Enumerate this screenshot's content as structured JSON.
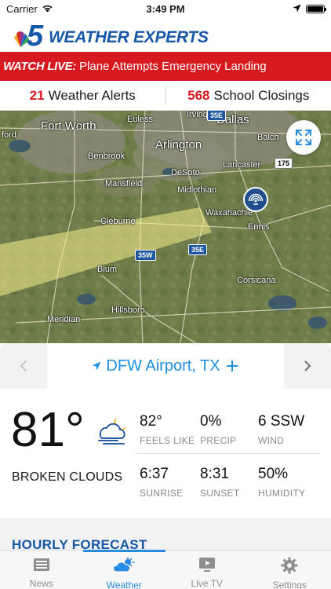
{
  "status_bar": {
    "carrier": "Carrier",
    "time": "3:49 PM"
  },
  "brand": {
    "logo_number": "5",
    "title": "WEATHER EXPERTS"
  },
  "breaking": {
    "tag": "WATCH LIVE:",
    "text": "Plane Attempts Emergency Landing"
  },
  "alerts": [
    {
      "count": "21",
      "label": "Weather Alerts"
    },
    {
      "count": "568",
      "label": "School Closings"
    }
  ],
  "map": {
    "labels": {
      "fort_worth": "Fort Worth",
      "euless": "Euless",
      "irving": "Irving",
      "dallas": "Dallas",
      "arlington": "Arlington",
      "benbrook": "Benbrook",
      "desoto": "DeSoto",
      "lancaster": "Lancaster",
      "balch": "Balch",
      "mansfield": "Mansfield",
      "midlothian": "Midlothian",
      "waxahachie": "Waxahachie",
      "cleburne": "Cleburne",
      "ennis": "Ennis",
      "blum": "Blum",
      "corsicana": "Corsicana",
      "hillsboro": "Hillsboro",
      "meridian": "Meridian",
      "ford": "ford"
    },
    "shields": {
      "i35w": "35W",
      "i35e": "35E",
      "i35e_top": "35E",
      "sh175": "175"
    }
  },
  "location": {
    "name": "DFW Airport, TX"
  },
  "current": {
    "temperature": "81°",
    "condition": "BROKEN CLOUDS",
    "stats": [
      {
        "value": "82°",
        "label": "FEELS LIKE"
      },
      {
        "value": "0%",
        "label": "PRECIP"
      },
      {
        "value": "6 SSW",
        "label": "WIND"
      },
      {
        "value": "6:37",
        "label": "SUNRISE"
      },
      {
        "value": "8:31",
        "label": "SUNSET"
      },
      {
        "value": "50%",
        "label": "HUMIDITY"
      }
    ]
  },
  "hourly": {
    "title": "HOURLY FORECAST"
  },
  "tabs": [
    {
      "label": "News",
      "icon": "news-icon"
    },
    {
      "label": "Weather",
      "icon": "weather-icon",
      "active": true
    },
    {
      "label": "Live TV",
      "icon": "live-tv-icon"
    },
    {
      "label": "Settings",
      "icon": "gear-icon"
    }
  ],
  "colors": {
    "brand_blue": "#1657a8",
    "alert_red": "#d71920",
    "accent_blue": "#2a8ce0",
    "location_blue": "#1f8fe0"
  }
}
